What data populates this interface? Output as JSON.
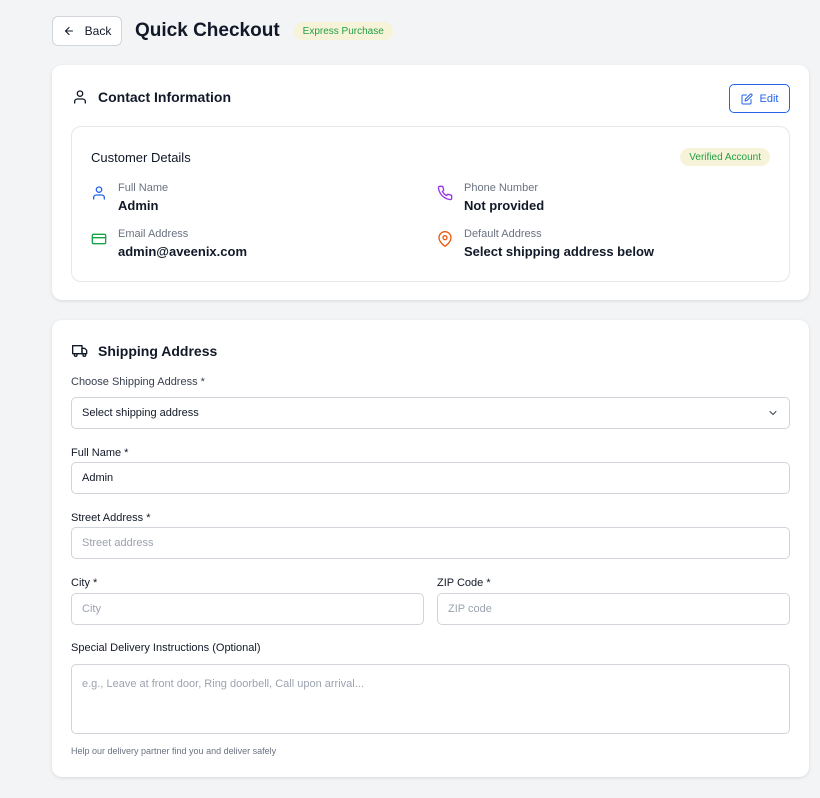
{
  "header": {
    "back_label": "Back",
    "title": "Quick Checkout",
    "badge": "Express Purchase"
  },
  "contact": {
    "title": "Contact Information",
    "edit_label": "Edit",
    "details_title": "Customer Details",
    "verified_badge": "Verified Account",
    "full_name_label": "Full Name",
    "full_name_value": "Admin",
    "phone_label": "Phone Number",
    "phone_value": "Not provided",
    "email_label": "Email Address",
    "email_value": "admin@aveenix.com",
    "default_address_label": "Default Address",
    "default_address_value": "Select shipping address below"
  },
  "shipping": {
    "title": "Shipping Address",
    "choose_label": "Choose Shipping Address *",
    "choose_value": "Select shipping address",
    "full_name_label": "Full Name *",
    "full_name_value": "Admin",
    "street_label": "Street Address *",
    "street_placeholder": "Street address",
    "city_label": "City *",
    "city_placeholder": "City",
    "zip_label": "ZIP Code *",
    "zip_placeholder": "ZIP code",
    "instructions_label": "Special Delivery Instructions (Optional)",
    "instructions_placeholder": "e.g., Leave at front door, Ring doorbell, Call upon arrival...",
    "help_text": "Help our delivery partner find you and deliver safely"
  },
  "colors": {
    "accent": "#2563eb",
    "badge_green": "#22a045",
    "badge_bg": "#f7f3d9",
    "phone_icon": "#9333ea",
    "email_icon": "#16a34a",
    "address_icon": "#ea580c"
  },
  "icons": [
    "arrow-left-icon",
    "user-icon",
    "edit-icon",
    "phone-icon",
    "credit-card-icon",
    "map-pin-icon",
    "truck-icon",
    "chevron-down-icon"
  ]
}
